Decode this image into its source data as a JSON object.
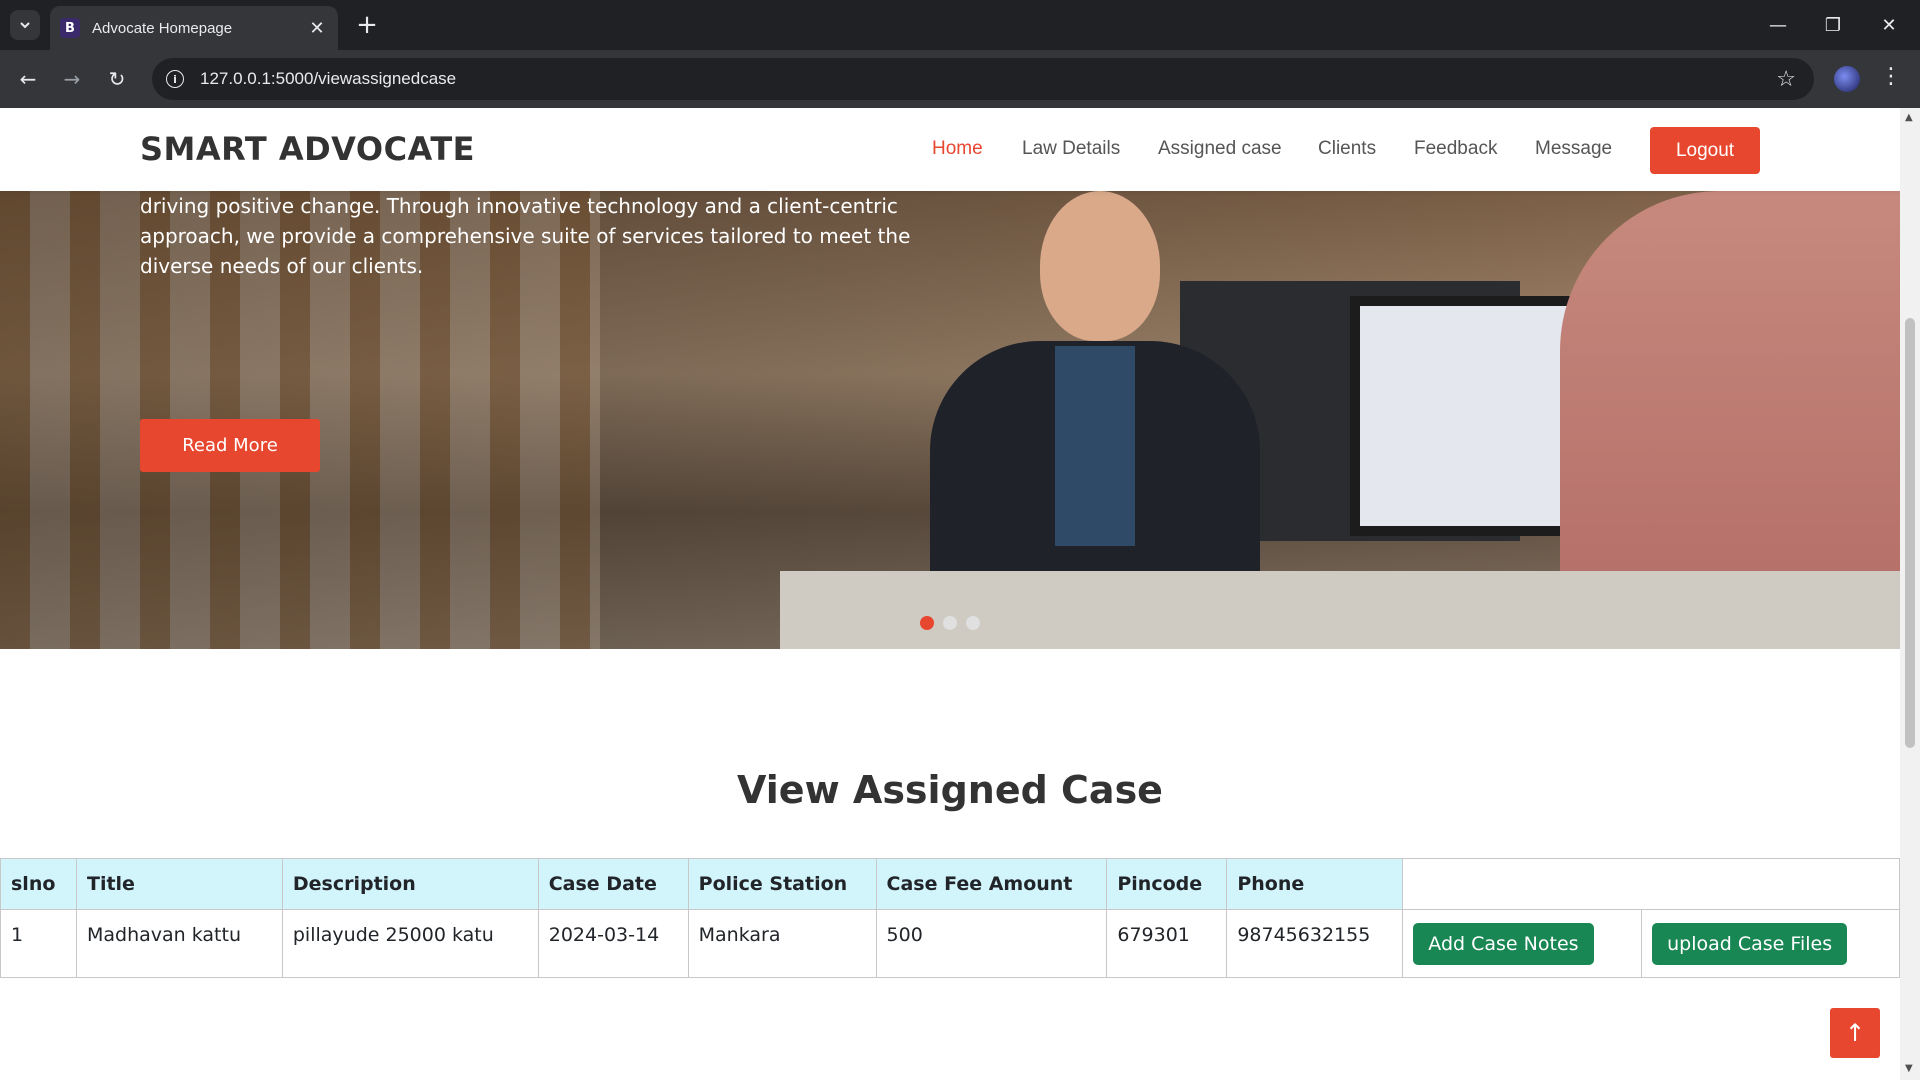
{
  "browser": {
    "tab_favicon": "B",
    "tab_title": "Advocate Homepage",
    "url": "127.0.0.1:5000/viewassignedcase",
    "icons": [
      "tab-search-icon",
      "close-icon",
      "plus-icon",
      "minimize-icon",
      "restore-icon",
      "close-window-icon",
      "back-icon",
      "forward-icon",
      "reload-icon",
      "info-icon",
      "star-icon",
      "profile-icon",
      "kebab-menu-icon"
    ]
  },
  "navbar": {
    "brand": "SMART ADVOCATE",
    "links": [
      "Home",
      "Law Details",
      "Assigned case",
      "Clients",
      "Feedback",
      "Message"
    ],
    "active_link": "Home",
    "logout_label": "Logout"
  },
  "hero": {
    "text": "driving positive change. Through innovative technology and a client-centric approach, we provide a comprehensive suite of services tailored to meet the diverse needs of our clients.",
    "read_more_label": "Read More",
    "slides": 3,
    "active_slide": 1
  },
  "section": {
    "title": "View Assigned Case"
  },
  "table": {
    "headers": [
      "slno",
      "Title",
      "Description",
      "Case Date",
      "Police Station",
      "Case Fee Amount",
      "Pincode",
      "Phone"
    ],
    "rows": [
      {
        "slno": "1",
        "title": "Madhavan kattu",
        "description": "pillayude 25000 katu",
        "case_date": "2024-03-14",
        "police_station": "Mankara",
        "case_fee": "500",
        "pincode": "679301",
        "phone": "98745632155",
        "add_notes_label": "Add Case Notes",
        "upload_files_label": "upload Case Files"
      }
    ]
  },
  "colors": {
    "accent": "#e8472f",
    "button_green": "#198754",
    "header_cell": "#d2f4fb"
  }
}
